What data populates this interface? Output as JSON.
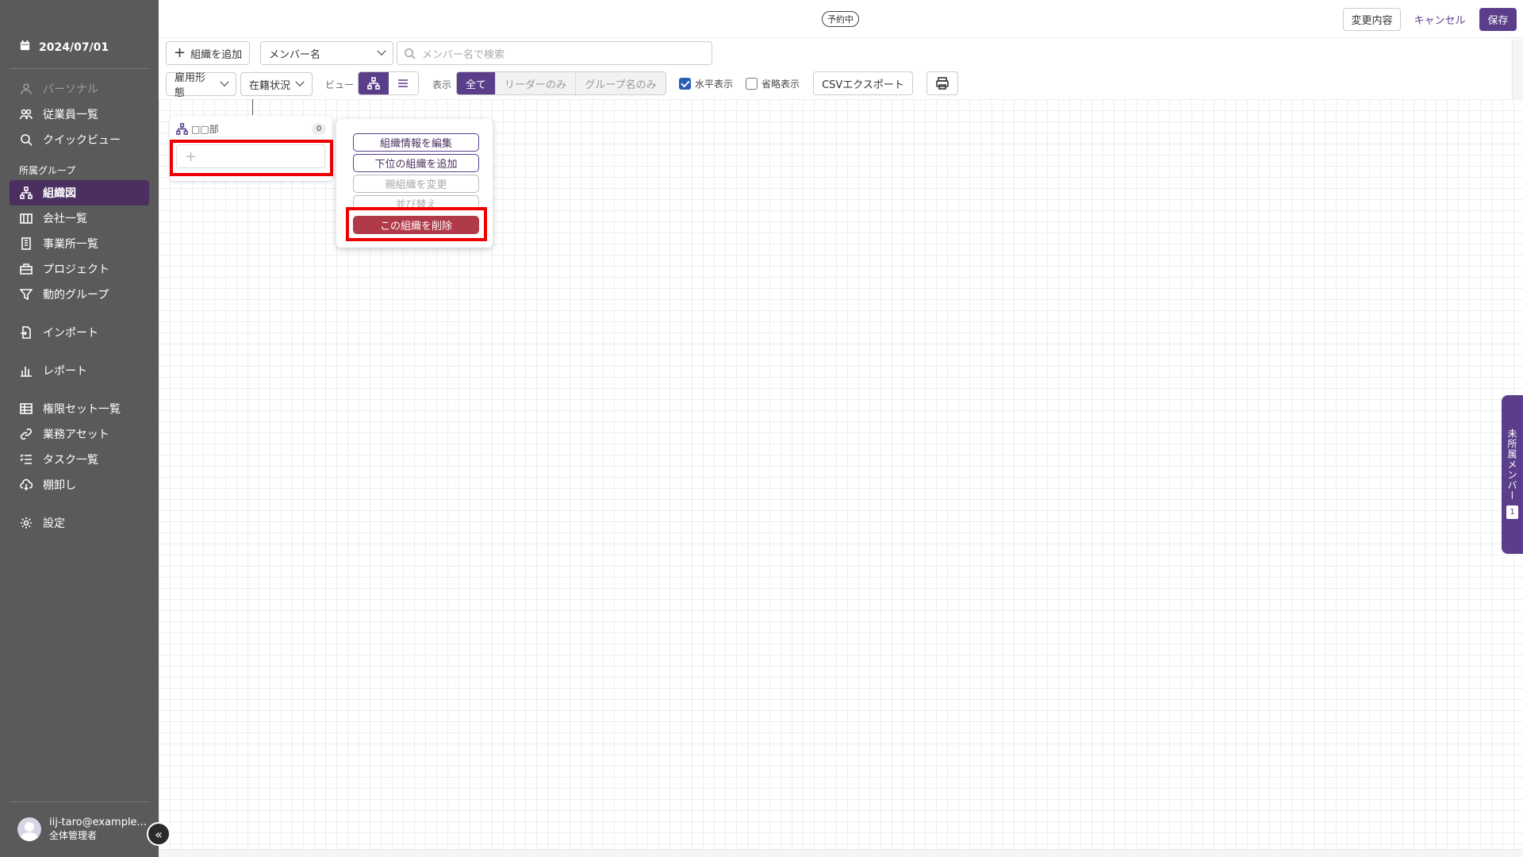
{
  "sidebar": {
    "date": "2024/07/01",
    "items": [
      {
        "label": "パーソナル"
      },
      {
        "label": "従業員一覧"
      },
      {
        "label": "クイックビュー"
      },
      {
        "label": "組織図"
      },
      {
        "label": "会社一覧"
      },
      {
        "label": "事業所一覧"
      },
      {
        "label": "プロジェクト"
      },
      {
        "label": "動的グループ"
      },
      {
        "label": "インポート"
      },
      {
        "label": "レポート"
      },
      {
        "label": "権限セット一覧"
      },
      {
        "label": "業務アセット"
      },
      {
        "label": "タスク一覧"
      },
      {
        "label": "棚卸し"
      },
      {
        "label": "設定"
      }
    ],
    "section_heading": "所属グループ",
    "user": {
      "email": "iij-taro@example...",
      "role": "全体管理者"
    }
  },
  "header": {
    "status_badge": "予約中",
    "changes_label": "変更内容",
    "cancel_label": "キャンセル",
    "save_label": "保存"
  },
  "toolbar": {
    "add_org_label": "組織を追加",
    "member_select": "メンバー名",
    "search_placeholder": "メンバー名で検索",
    "employment_type": "雇用形態",
    "enrollment_status": "在籍状況",
    "view_label": "ビュー",
    "display_label": "表示",
    "display_options": [
      "全て",
      "リーダーのみ",
      "グループ名のみ"
    ],
    "selected_display": "全て",
    "horizontal_label": "水平表示",
    "horizontal_checked": true,
    "abbrev_label": "省略表示",
    "abbrev_checked": false,
    "csv_label": "CSVエクスポート"
  },
  "org_node": {
    "name": "□□部",
    "count": "0",
    "add_symbol": "+"
  },
  "context_menu": {
    "items": [
      {
        "label": "組織情報を編集",
        "state": "enabled"
      },
      {
        "label": "下位の組織を追加",
        "state": "enabled"
      },
      {
        "label": "親組織を変更",
        "state": "disabled"
      },
      {
        "label": "並び替え",
        "state": "disabled"
      },
      {
        "label": "この組織を削除",
        "state": "danger"
      }
    ]
  },
  "side_tab": {
    "label": "未所属メンバー",
    "count": "1"
  },
  "colors": {
    "accent": "#5b3e8a",
    "sidebar_bg": "#5a5a5a",
    "danger": "#b03a48",
    "highlight": "#ee0000"
  }
}
